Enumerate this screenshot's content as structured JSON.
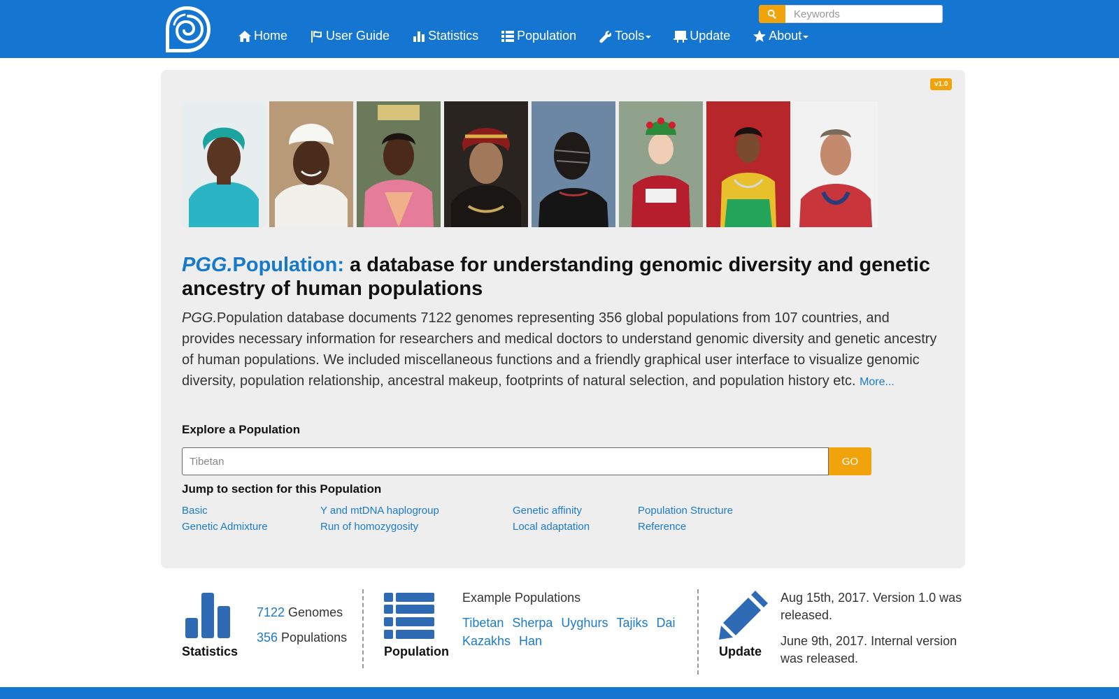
{
  "colors": {
    "nav_bg": "#1476d1",
    "accent": "#f0a30a",
    "link": "#1a7bc9",
    "icon": "#2e6bb4",
    "jumbo_bg": "#eeeeee"
  },
  "nav": {
    "items": [
      {
        "label": "Home",
        "icon": "home-icon"
      },
      {
        "label": "User Guide",
        "icon": "flag-icon"
      },
      {
        "label": "Statistics",
        "icon": "bar-chart-icon"
      },
      {
        "label": "Population",
        "icon": "list-icon"
      },
      {
        "label": "Tools",
        "icon": "wrench-icon",
        "dropdown": true
      },
      {
        "label": "Update",
        "icon": "blackboard-icon"
      },
      {
        "label": "About",
        "icon": "star-icon",
        "dropdown": true
      }
    ],
    "search_placeholder": "Keywords"
  },
  "hero": {
    "version": "v1.0",
    "headline_brand_prefix": "PGG.",
    "headline_brand_suffix": "Population:",
    "headline_rest": " a database for understanding genomic diversity and genetic ancestry of human populations",
    "desc_prefix": "PGG.",
    "desc_text": "Population database documents 7122 genomes representing 356 global populations from 107 countries, and provides necessary information for researchers and medical doctors to understand genomic diversity and genetic ancestry of human populations. We included miscellaneous functions and a friendly graphical user interface to visualize genomic diversity, population relationship, ancestral makeup, footprints of natural selection, and population history etc.",
    "more_label": "More...",
    "portrait_count": 8
  },
  "explore": {
    "title": "Explore a Population",
    "placeholder": "Tibetan",
    "go_label": "GO"
  },
  "jump": {
    "title": "Jump to section for this Population",
    "links": [
      "Basic",
      "Y and mtDNA haplogroup",
      "Genetic affinity",
      "Population Structure",
      "Genetic Admixture",
      "Run of homozygosity",
      "Local adaptation",
      "Reference"
    ]
  },
  "statistics": {
    "label": "Statistics",
    "genomes_num": "7122",
    "genomes_label": " Genomes",
    "populations_num": "356",
    "populations_label": " Populations"
  },
  "population": {
    "label": "Population",
    "example_title": "Example Populations",
    "examples": [
      "Tibetan",
      "Sherpa",
      "Uyghurs",
      "Tajiks",
      "Dai",
      "Kazakhs",
      "Han"
    ]
  },
  "update": {
    "label": "Update",
    "entries": [
      "Aug 15th, 2017. Version 1.0 was released.",
      "June 9th, 2017. Internal version was released."
    ]
  }
}
